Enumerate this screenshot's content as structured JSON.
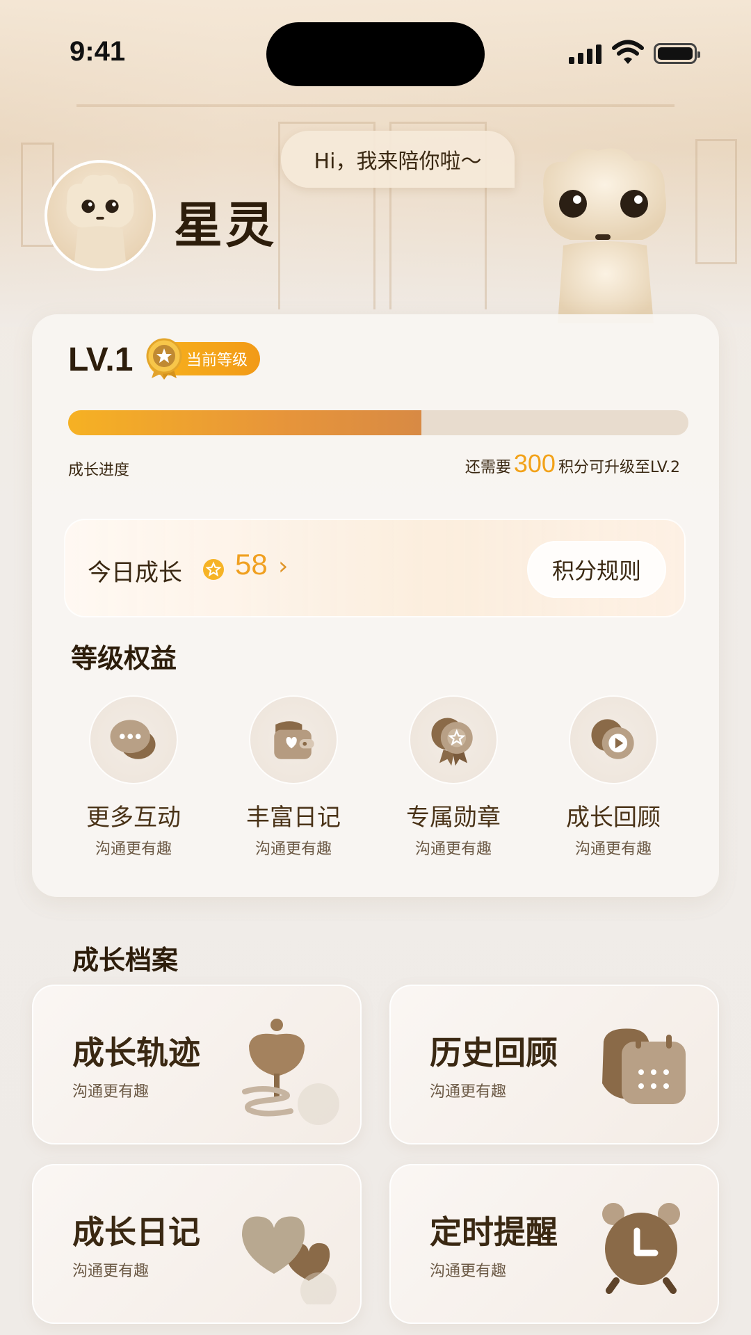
{
  "status_bar": {
    "time": "9:41"
  },
  "profile": {
    "name": "星灵",
    "greeting": "Hi，我来陪你啦～"
  },
  "level": {
    "label": "LV.1",
    "badge": "当前等级",
    "progress_fraction": 0.57,
    "progress_label": "成长进度",
    "note_prefix": "还需要",
    "points_needed": "300",
    "note_suffix": "积分可升级至LV.2"
  },
  "today": {
    "label": "今日成长",
    "value": "58",
    "arrow": "›",
    "rules_button": "积分规则"
  },
  "benefits": {
    "title": "等级权益",
    "items": [
      {
        "title": "更多互动",
        "subtitle": "沟通更有趣",
        "icon": "chat-bubbles-icon"
      },
      {
        "title": "丰富日记",
        "subtitle": "沟通更有趣",
        "icon": "wallet-heart-icon"
      },
      {
        "title": "专属勋章",
        "subtitle": "沟通更有趣",
        "icon": "star-medal-icon"
      },
      {
        "title": "成长回顾",
        "subtitle": "沟通更有趣",
        "icon": "play-circle-icon"
      }
    ]
  },
  "archive": {
    "title": "成长档案",
    "tiles": [
      {
        "title": "成长轨迹",
        "subtitle": "沟通更有趣",
        "icon": "sprout-icon"
      },
      {
        "title": "历史回顾",
        "subtitle": "沟通更有趣",
        "icon": "calendar-icon"
      },
      {
        "title": "成长日记",
        "subtitle": "沟通更有趣",
        "icon": "hearts-icon"
      },
      {
        "title": "定时提醒",
        "subtitle": "沟通更有趣",
        "icon": "alarm-clock-icon"
      }
    ]
  },
  "colors": {
    "accent_orange": "#f2a219",
    "text_brown": "#3a2812",
    "progress_track": "#e8dcce"
  }
}
